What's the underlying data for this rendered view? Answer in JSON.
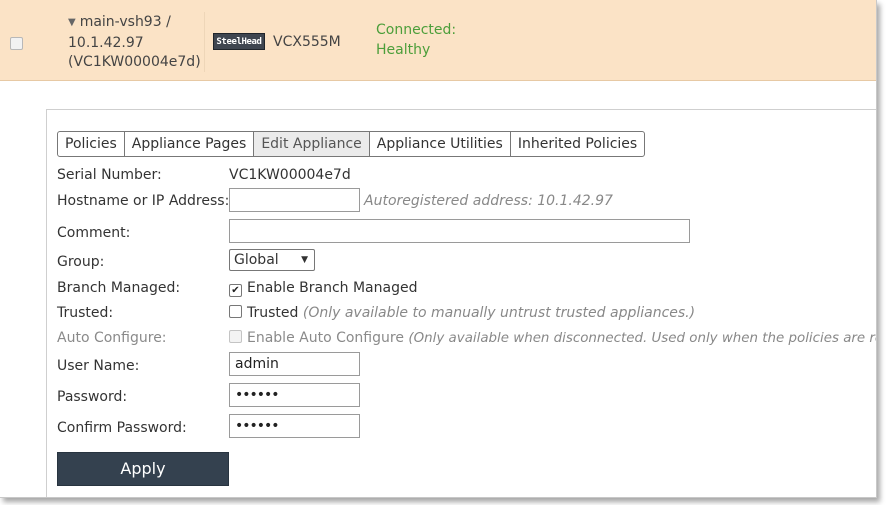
{
  "appliance": {
    "name_line1": "main-vsh93 /",
    "name_line2": "10.1.42.97",
    "name_line3": "(VC1KW00004e7d)",
    "brand_logo": "SteelHead",
    "model": "VCX555M",
    "status_line1": "Connected:",
    "status_line2": "Healthy"
  },
  "tabs": [
    "Policies",
    "Appliance Pages",
    "Edit Appliance",
    "Appliance Utilities",
    "Inherited Policies"
  ],
  "form": {
    "serial_label": "Serial Number:",
    "serial_value": "VC1KW00004e7d",
    "hostname_label": "Hostname or IP Address:",
    "hostname_value": "",
    "autoreg_note": "Autoregistered address: 10.1.42.97",
    "comment_label": "Comment:",
    "comment_value": "",
    "group_label": "Group:",
    "group_value": "Global",
    "branch_label": "Branch Managed:",
    "branch_check_label": "Enable Branch Managed",
    "trusted_label": "Trusted:",
    "trusted_check_label": "Trusted",
    "trusted_note": "(Only available to manually untrust trusted appliances.)",
    "autoconf_label": "Auto Configure:",
    "autoconf_check_label": "Enable Auto Configure",
    "autoconf_note": "(Only available when disconnected. Used only when the policies are ready.)",
    "username_label": "User Name:",
    "username_value": "admin",
    "password_label": "Password:",
    "password_value": "••••••",
    "confirm_label": "Confirm Password:",
    "confirm_value": "••••••",
    "apply_label": "Apply"
  },
  "colors": {
    "header_bg": "#fbe3c6",
    "status_green": "#4c9e3a",
    "apply_bg": "#34414f"
  }
}
